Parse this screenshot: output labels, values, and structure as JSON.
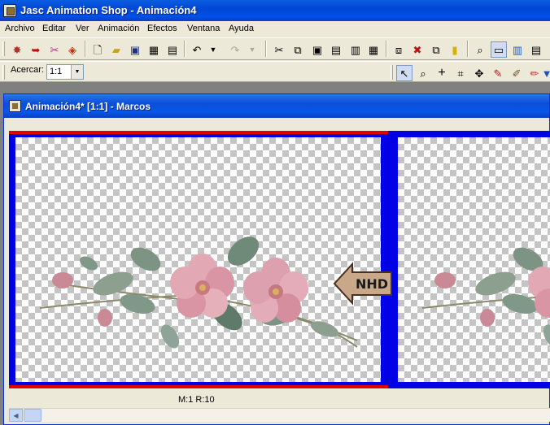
{
  "app": {
    "title": "Jasc Animation Shop - Animación4"
  },
  "menu": [
    "Archivo",
    "Editar",
    "Ver",
    "Animación",
    "Efectos",
    "Ventana",
    "Ayuda"
  ],
  "toolbar": {
    "main_icons": [
      "wizard-icon",
      "banner-icon",
      "transition-icon",
      "effects-icon",
      "new-icon",
      "open-icon",
      "save-icon",
      "save-frames-icon",
      "properties-icon",
      "undo-icon",
      "redo-icon",
      "cut-icon",
      "copy-icon",
      "paste-icon",
      "paste-as-new-icon",
      "paste-into-icon",
      "crop-icon",
      "delete-icon",
      "duplicate-icon",
      "insert-icon",
      "view-animation-icon",
      "frame-properties-icon",
      "color-icon",
      "filmstrip-icon"
    ],
    "zoom_label": "Acercar:",
    "zoom_value": "1:1",
    "tool_icons": [
      "arrow-tool-icon",
      "zoom-tool-icon",
      "cross-tool-icon",
      "crop-tool-icon",
      "move-tool-icon",
      "dropper-tool-icon",
      "brush-tool-icon",
      "eraser-tool-icon",
      "fill-tool-icon"
    ]
  },
  "document": {
    "title": "Animación4* [1:1] - Marcos",
    "frames": [
      {
        "image": "flower-bouquet"
      },
      {
        "image": "flower-bouquet"
      }
    ],
    "watermark": "NHD",
    "status": "M:1   R:10"
  },
  "colors": {
    "frame_border": "#0000e6",
    "frame_marker": "#e00000",
    "title_bar": "#0047d6"
  }
}
